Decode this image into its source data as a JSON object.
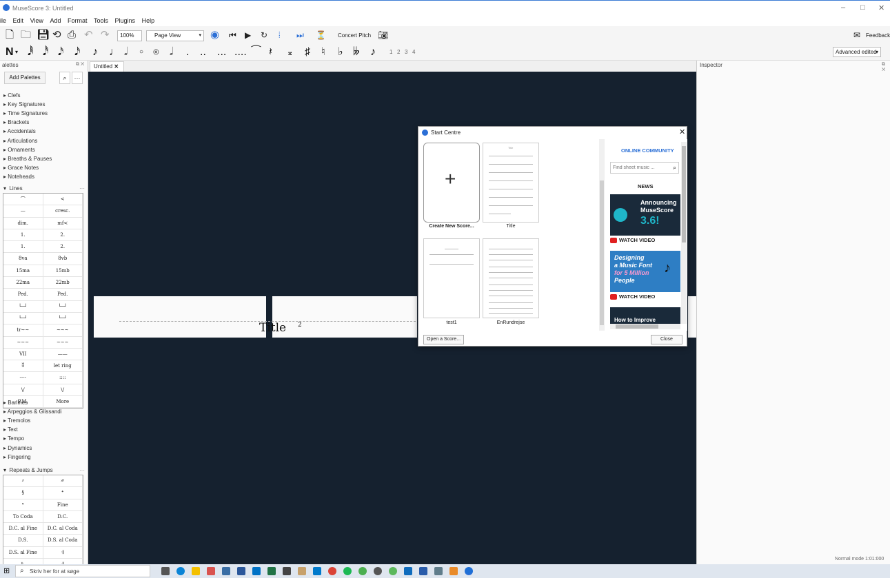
{
  "window": {
    "title": "MuseScore 3: Untitled",
    "minimize": "–",
    "maximize": "□",
    "close": "✕"
  },
  "menu": [
    "ile",
    "Edit",
    "View",
    "Add",
    "Format",
    "Tools",
    "Plugins",
    "Help"
  ],
  "toolbar": {
    "zoom": "100%",
    "view_mode": "Page View",
    "concert_pitch": "Concert Pitch",
    "feedback": "Feedback",
    "workspace": "Advanced edited"
  },
  "note_input": {
    "voices": [
      "1",
      "2",
      "3",
      "4"
    ]
  },
  "palettes": {
    "header": "alettes",
    "add_button": "Add Palettes",
    "more_icon": "···",
    "categories_top": [
      "Clefs",
      "Key Signatures",
      "Time Signatures",
      "Brackets",
      "Accidentals",
      "Articulations",
      "Ornaments",
      "Breaths & Pauses",
      "Grace Notes",
      "Noteheads"
    ],
    "lines_label": "Lines",
    "lines_grid": [
      [
        "⌒",
        "<"
      ],
      [
        "—",
        "cresc."
      ],
      [
        "dim.",
        "mf<"
      ],
      [
        "1.",
        "2."
      ],
      [
        "1.",
        "2."
      ],
      [
        "8va",
        "8vb"
      ],
      [
        "15ma",
        "15mb"
      ],
      [
        "22ma",
        "22mb"
      ],
      [
        "Ped.",
        "Ped."
      ],
      [
        "└─┘",
        "└─┘"
      ],
      [
        "└─┘",
        "└─┘"
      ],
      [
        "tr~~",
        "~~~"
      ],
      [
        "~~~",
        "~~~"
      ],
      [
        "VII",
        "——"
      ],
      [
        "⁑",
        "let ring"
      ],
      [
        "----",
        "::::"
      ],
      [
        "\\/",
        "\\/"
      ],
      [
        "P.M.",
        "More"
      ]
    ],
    "categories_mid": [
      "Barlines",
      "Arpeggios & Glissandi",
      "Tremolos",
      "Text",
      "Tempo",
      "Dynamics",
      "Fingering"
    ],
    "repeats_label": "Repeats & Jumps",
    "repeats_grid": [
      [
        "𝄎",
        "𝄏"
      ],
      [
        "§",
        "𝄌"
      ],
      [
        "𝄌",
        "Fine"
      ],
      [
        "To Coda",
        "D.C."
      ],
      [
        "D.C. al Fine",
        "D.C. al Coda"
      ],
      [
        "D.S.",
        "D.S. al Coda"
      ],
      [
        "D.S. al Fine",
        "𝄇"
      ],
      [
        "𝄆",
        "𝄇"
      ]
    ]
  },
  "tabs": [
    {
      "label": "Untitled"
    }
  ],
  "score": {
    "title": "Title",
    "superscript": "2"
  },
  "inspector": {
    "title": "Inspector"
  },
  "start_centre": {
    "title": "Start Centre",
    "scores": [
      {
        "label": "Create New Score..."
      },
      {
        "label": "Title"
      },
      {
        "label": "test1"
      },
      {
        "label": "EnRundrejse"
      }
    ],
    "open_button": "Open a Score...",
    "close_button": "Close",
    "community": {
      "heading": "ONLINE COMMUNITY",
      "search_placeholder": "Find sheet music ...",
      "news_heading": "NEWS",
      "news": [
        {
          "line1": "Announcing",
          "line2": "MuseScore",
          "line3": "3.6!",
          "watch": "WATCH VIDEO"
        },
        {
          "line1": "Designing",
          "line2": "a Music Font",
          "line3": "for 5 Million",
          "line4": "People",
          "watch": "WATCH VIDEO"
        },
        {
          "line1": "How to Improve"
        }
      ]
    }
  },
  "status": {
    "mode": "Normal mode",
    "position": "1:01:000"
  },
  "taskbar": {
    "search_placeholder": "Skriv her for at søge"
  }
}
